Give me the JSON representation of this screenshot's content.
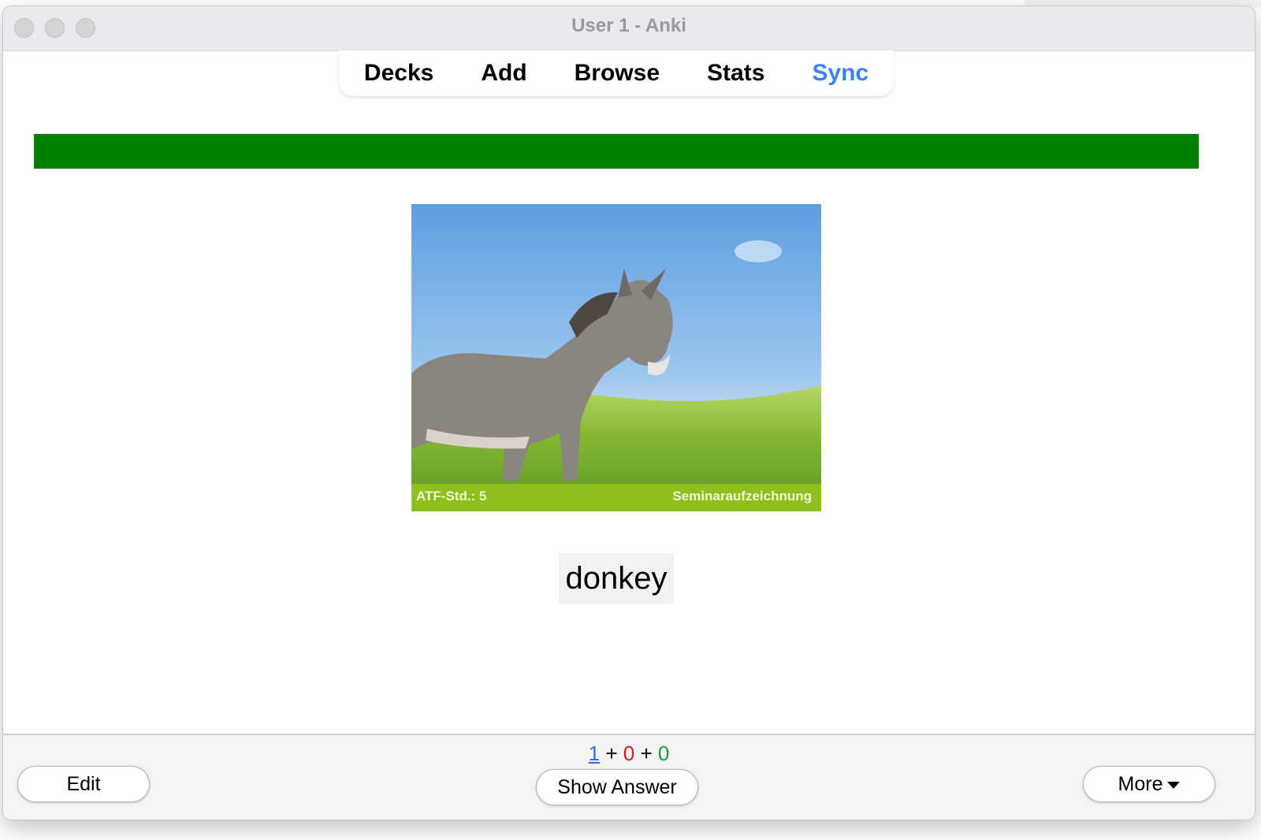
{
  "window": {
    "title": "User 1 - Anki"
  },
  "menu": {
    "decks": "Decks",
    "add": "Add",
    "browse": "Browse",
    "stats": "Stats",
    "sync": "Sync",
    "sync_color": "#3a82f7"
  },
  "progress": {
    "fraction": 1.0,
    "color": "#008000"
  },
  "card": {
    "image_caption_left": "ATF-Std.: 5",
    "image_caption_right": "Seminaraufzeichnung",
    "word": "donkey"
  },
  "counts": {
    "new": "1",
    "sep1": " + ",
    "learning": "0",
    "sep2": " + ",
    "review": "0"
  },
  "buttons": {
    "edit": "Edit",
    "show_answer": "Show Answer",
    "more": "More"
  },
  "icons": {
    "more_caret": "caret-down-icon"
  }
}
